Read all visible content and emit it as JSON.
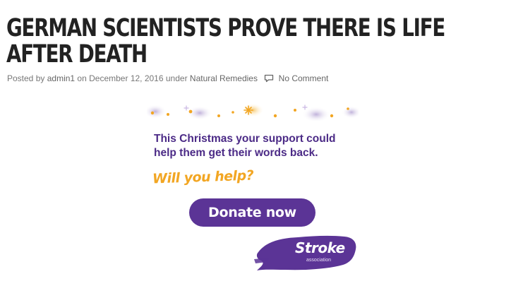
{
  "post": {
    "title": "GERMAN SCIENTISTS PROVE THERE IS LIFE AFTER DEATH",
    "meta": {
      "posted_by_label": "Posted by",
      "author": "admin1",
      "on_label": "on",
      "date": "December 12, 2016",
      "under_label": "under",
      "category": "Natural Remedies",
      "comments": "No Comment"
    }
  },
  "ad": {
    "message": "This Christmas your support could help them get their words back.",
    "call_to_action": "Will you help?",
    "button_label": "Donate now",
    "brand_name": "Stroke",
    "brand_sub": "association",
    "colors": {
      "purple": "#5b3496",
      "orange": "#f2a623",
      "text_purple": "#4b2a86"
    }
  },
  "icons": [
    "comment-icon",
    "snowflake-icon"
  ]
}
